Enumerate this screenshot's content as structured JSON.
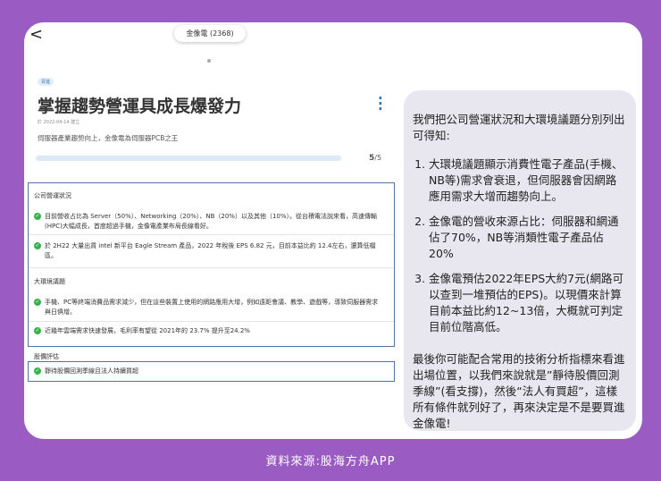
{
  "header": {
    "stock_pill": "金像電 (2368)",
    "back": "<"
  },
  "article": {
    "tag": "買進",
    "title": "掌握趨勢營運具成長爆發力",
    "date": "於 2022-04-14 建立",
    "subtitle": "伺服器產業趨勢向上，金像電為伺服器PCB之王",
    "progress": {
      "current": "5",
      "total": "/5",
      "fraction": 1.0
    }
  },
  "sections": [
    {
      "title": "公司營運狀況",
      "items": [
        "目前營收占比為 Server（50%）、Networking（20%）、NB（20%）以及其他（10%）。從台積電法說來看，高速傳輸(HPC)大幅成長，首度超過手機，金像電產業布局長線看好。",
        "於 2H22 大量出貨 intel 新平台 Eagle Stream 產品，2022 年稅後 EPS 6.82 元，目前本益比約 12.4左右，還算低檔區。"
      ]
    },
    {
      "title": "大環境議題",
      "items": [
        "手機、PC等終端消費品需求減少，但在這些裝置上使用的網路應用大增，例如遠距會議、教學、遊戲等，導致伺服器需求與日俱增。",
        "近幾年雲端需求快速發展，毛利率有望從 2021年的 23.7% 提升至24.2%"
      ]
    },
    {
      "title": "股價評估",
      "items": [
        "靜待股價回測季線且法人持續買超"
      ]
    }
  ],
  "panel": {
    "intro": "我們把公司營運狀況和大環境議題分別列出可得知:",
    "points": [
      "大環境議題顯示消費性電子產品(手機、NB等)需求會衰退，但伺服器會因網路應用需求大增而趨勢向上。",
      "金像電的營收來源占比：伺服器和網通佔了70%，NB等消類性電子產品佔20%",
      "金像電預估2022年EPS大約7元(網路可以查到一堆預估的EPS)。以現價來計算目前本益比約12~13倍，大概就可判定目前位階高低。"
    ],
    "outro": "最後你可能配合常用的技術分析指標來看進出場位置，以我們來說就是”靜待股價回測季線”(看支撐)，然後“法人有買超”，這樣所有條件就列好了，再來決定是不是要買進金像電!"
  },
  "caption": "資料來源:股海方舟APP"
}
